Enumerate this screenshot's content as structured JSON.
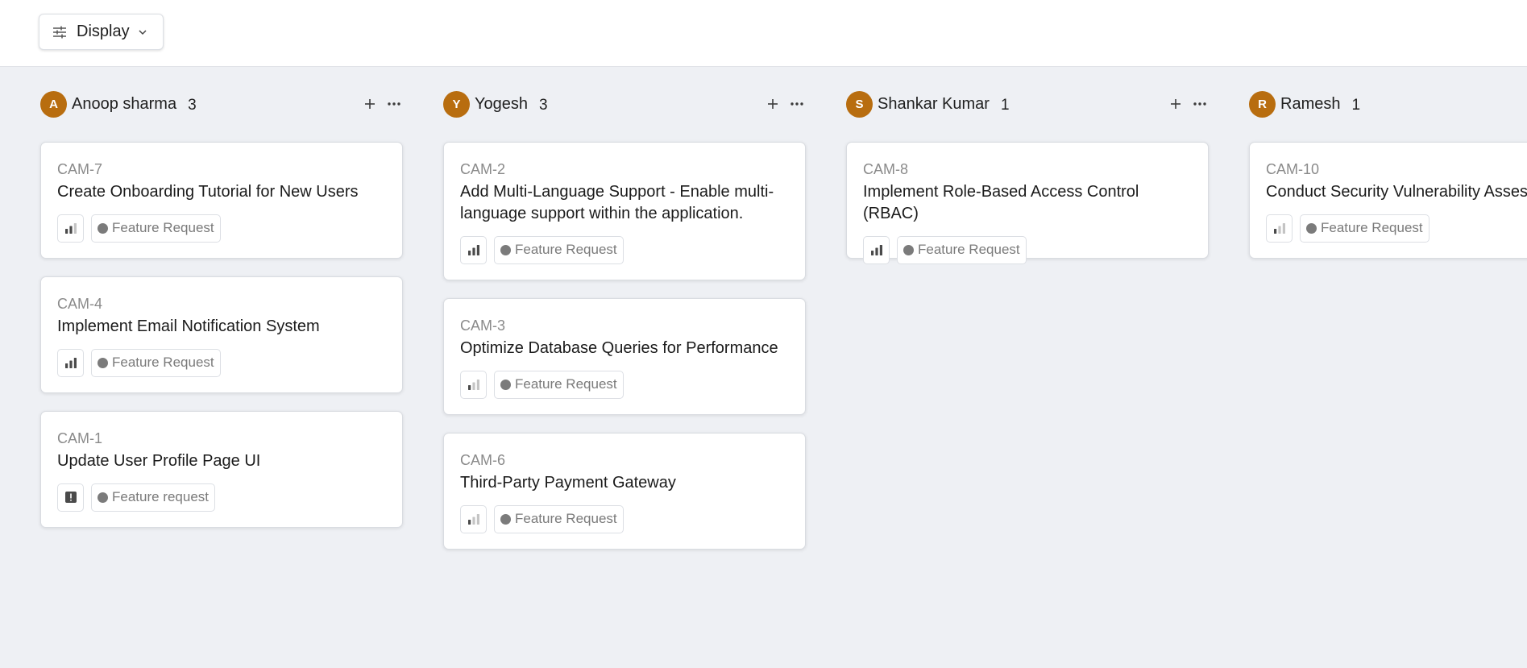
{
  "toolbar": {
    "display_label": "Display"
  },
  "columns": [
    {
      "initial": "A",
      "name": "Anoop sharma",
      "count": "3",
      "cards": [
        {
          "id": "CAM-7",
          "title": "Create Onboarding Tutorial for New Users",
          "priority": "medium",
          "tag": "Feature Request"
        },
        {
          "id": "CAM-4",
          "title": "Implement Email Notification System",
          "priority": "high",
          "tag": "Feature Request"
        },
        {
          "id": "CAM-1",
          "title": "Update User Profile Page UI",
          "priority": "urgent",
          "tag": "Feature request"
        }
      ]
    },
    {
      "initial": "Y",
      "name": "Yogesh",
      "count": "3",
      "cards": [
        {
          "id": "CAM-2",
          "title": "Add Multi-Language Support - Enable multi-language support within the application.",
          "priority": "high",
          "tag": "Feature Request"
        },
        {
          "id": "CAM-3",
          "title": "Optimize Database Queries for Performance",
          "priority": "low",
          "tag": "Feature Request"
        },
        {
          "id": "CAM-6",
          "title": "Third-Party Payment Gateway",
          "priority": "low",
          "tag": "Feature Request"
        }
      ]
    },
    {
      "initial": "S",
      "name": "Shankar Kumar",
      "count": "1",
      "cards": [
        {
          "id": "CAM-8",
          "title": "Implement Role-Based Access Control (RBAC)",
          "priority": "high",
          "tag": "Feature Request"
        }
      ]
    },
    {
      "initial": "R",
      "name": "Ramesh",
      "count": "1",
      "cards": [
        {
          "id": "CAM-10",
          "title": "Conduct Security Vulnerability Asses",
          "priority": "low",
          "tag": "Feature Request"
        }
      ]
    }
  ],
  "colors": {
    "avatar": "#b86d0f",
    "board_bg": "#eef0f4",
    "tag_dot": "#7b7b7b"
  },
  "icons": {
    "display": "sliders-icon",
    "chevron": "chevron-down-icon",
    "add": "plus-icon",
    "more": "ellipsis-icon"
  }
}
